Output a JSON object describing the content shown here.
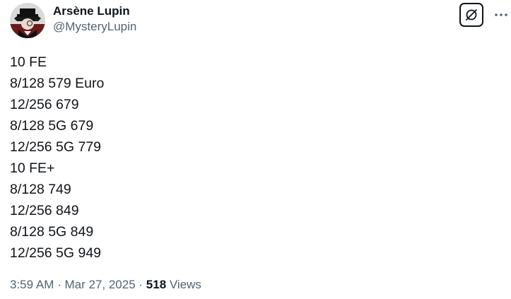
{
  "author": {
    "display_name": "Arsène Lupin",
    "handle": "@MysteryLupin"
  },
  "actions": {
    "grok_icon": "grok-icon",
    "more_icon": "more-icon"
  },
  "tweet": {
    "lines": [
      "10 FE",
      "8/128 579 Euro",
      "12/256 679",
      "8/128 5G 679",
      "12/256 5G 779",
      "10 FE+",
      "8/128 749",
      "12/256 849",
      "8/128 5G 849",
      "12/256 5G 949"
    ]
  },
  "meta": {
    "time": "3:59 AM",
    "separator": " · ",
    "date": "Mar 27, 2025",
    "views_count": "518",
    "views_label": " Views"
  },
  "colors": {
    "text_primary": "#0f1419",
    "text_secondary": "#536471",
    "background": "#ffffff"
  }
}
